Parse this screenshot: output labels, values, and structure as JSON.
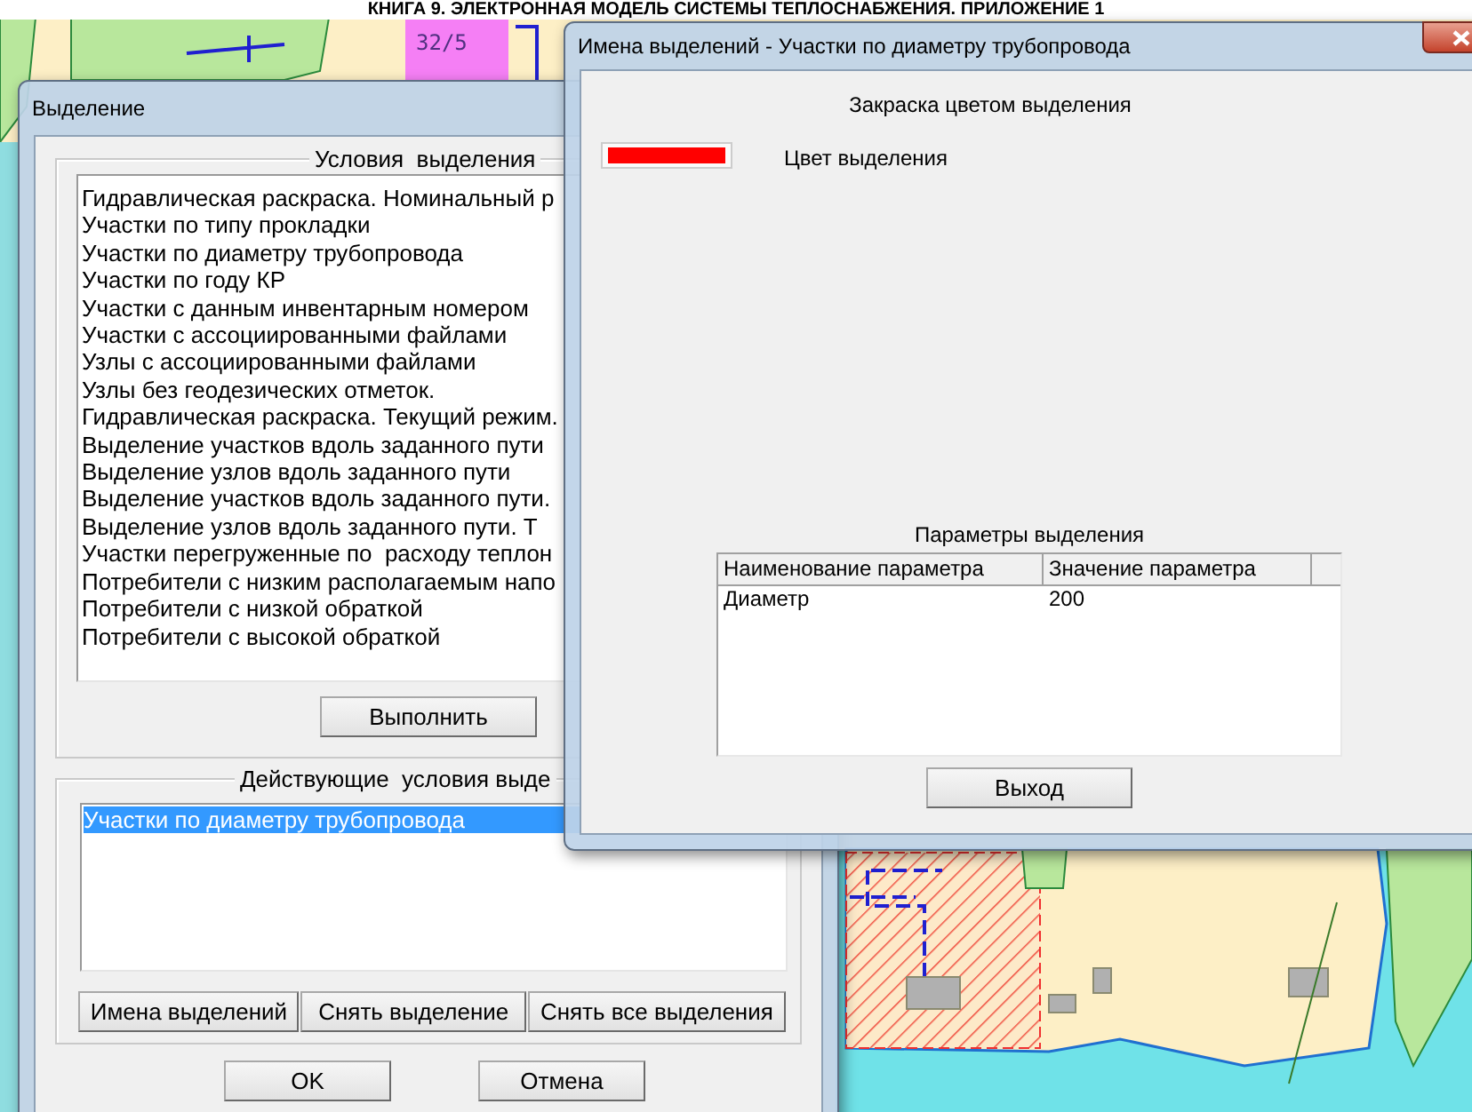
{
  "document_header": "КНИГА 9. ЭЛЕКТРОННАЯ МОДЕЛЬ СИСТЕМЫ ТЕПЛОСНАБЖЕНИЯ. ПРИЛОЖЕНИЕ 1",
  "map": {
    "label": "32/5"
  },
  "selection_dialog": {
    "title": "Выделение",
    "conditions_group": {
      "title": "Условия  выделения",
      "items": [
        {
          "label": "Гидравлическая раскраска. Номинальный р",
          "selected": false
        },
        {
          "label": "Участки по типу прокладки",
          "selected": false
        },
        {
          "label": "Участки по диаметру трубопровода",
          "selected": false
        },
        {
          "label": "Участки по году КР",
          "selected": false
        },
        {
          "label": "Участки с данным инвентарным номером",
          "selected": false
        },
        {
          "label": "Участки с ассоциированными файлами",
          "selected": false
        },
        {
          "label": "Узлы с ассоциированными файлами",
          "selected": false
        },
        {
          "label": "Узлы без геодезических отметок.",
          "selected": false
        },
        {
          "label": "Гидравлическая раскраска. Текущий режим.",
          "selected": false
        },
        {
          "label": "Выделение участков вдоль заданного пути",
          "selected": false
        },
        {
          "label": "Выделение узлов вдоль заданного пути",
          "selected": false
        },
        {
          "label": "Выделение участков вдоль заданного пути.",
          "selected": false
        },
        {
          "label": "Выделение узлов вдоль заданного пути. Т",
          "selected": false
        },
        {
          "label": "Участки перегруженные по  расходу теплон",
          "selected": false
        },
        {
          "label": "Потребители с низким располагаемым напо",
          "selected": false
        },
        {
          "label": "Потребители с низкой обраткой",
          "selected": false
        },
        {
          "label": "Потребители с высокой обраткой",
          "selected": false
        }
      ]
    },
    "execute_button": "Выполнить",
    "active_group": {
      "title": "Действующие  условия выде",
      "items": [
        {
          "label": "Участки по диаметру трубопровода",
          "selected": true
        }
      ]
    },
    "actions": [
      "Имена выделений",
      "Снять  выделение",
      "Снять все выделения"
    ],
    "buttons": [
      "OK",
      "Отмена"
    ]
  },
  "names_dialog": {
    "title": "Имена выделений - Участки по диаметру трубопровода",
    "fill_heading": "Закраска цветом выделения",
    "swatch": {
      "color": "#ff0000",
      "label": "Цвет выделения"
    },
    "params_heading": "Параметры выделения",
    "table": {
      "columns": [
        "Наименование параметра",
        "Значение параметра"
      ],
      "rows": [
        [
          "Диаметр",
          "200"
        ]
      ]
    },
    "exit_button": "Выход"
  }
}
